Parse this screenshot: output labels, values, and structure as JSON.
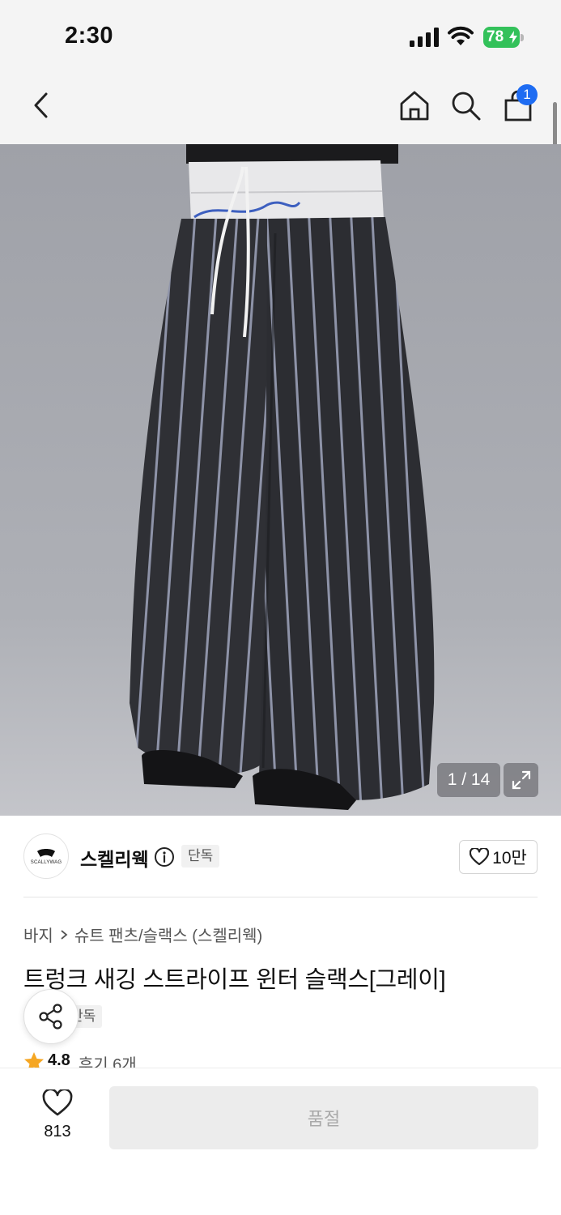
{
  "status_bar": {
    "time": "2:30",
    "battery": "78"
  },
  "nav": {
    "back_icon": "chevron-left-icon",
    "home_icon": "home-icon",
    "search_icon": "search-icon",
    "cart_icon": "bag-icon",
    "cart_count": "1"
  },
  "gallery": {
    "counter": "1 / 14",
    "expand_icon": "expand-icon",
    "waistband_script": "Scallywag"
  },
  "brand": {
    "name": "스켈리웩",
    "logo_text": "SCALLYWAG",
    "exclusive_badge": "단독",
    "likes": "10만"
  },
  "product": {
    "breadcrumb": [
      "바지",
      "슈트 팬츠/슬랙스 (스켈리웩)"
    ],
    "title": "트렁크 새깅 스트라이프 윈터 슬랙스[그레이]",
    "exclusive_badge": "단독",
    "rating": "4.8",
    "reviews": "후기 6개"
  },
  "bottom_bar": {
    "wish_count": "813",
    "action_label": "품절"
  },
  "colors": {
    "accent": "#1e6cf2",
    "battery": "#33c15a",
    "star": "#f5a623"
  }
}
